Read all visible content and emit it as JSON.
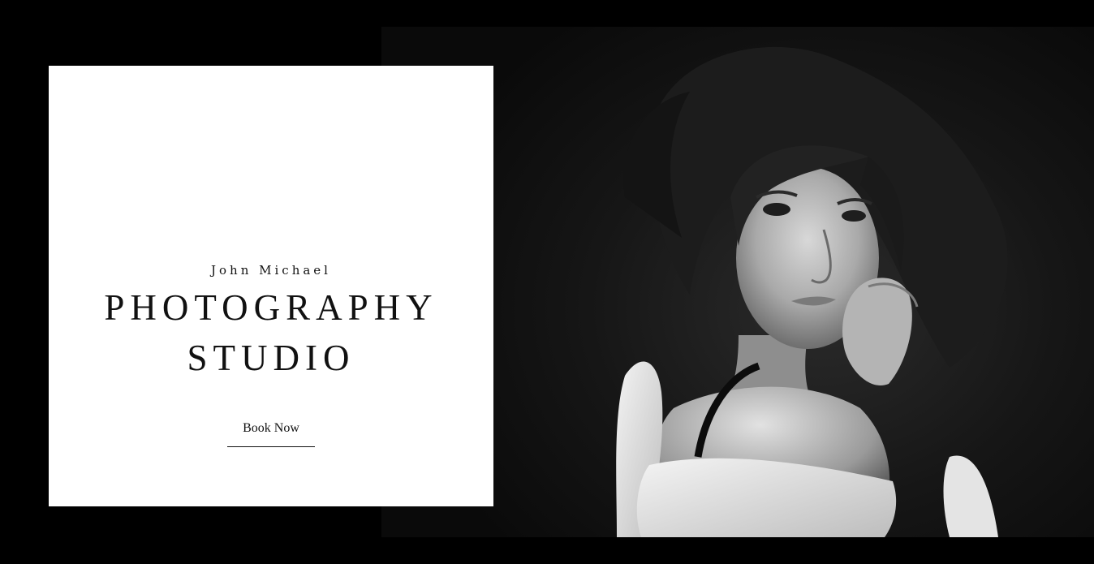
{
  "hero": {
    "eyebrow": "John Michael",
    "title_line_1": "PHOTOGRAPHY",
    "title_line_2": "STUDIO",
    "cta_label": "Book Now"
  },
  "photo": {
    "subject": "black-and-white portrait of a woman with wavy hair looking over her shoulder"
  },
  "colors": {
    "background": "#000000",
    "card": "#ffffff",
    "text": "#111111"
  }
}
